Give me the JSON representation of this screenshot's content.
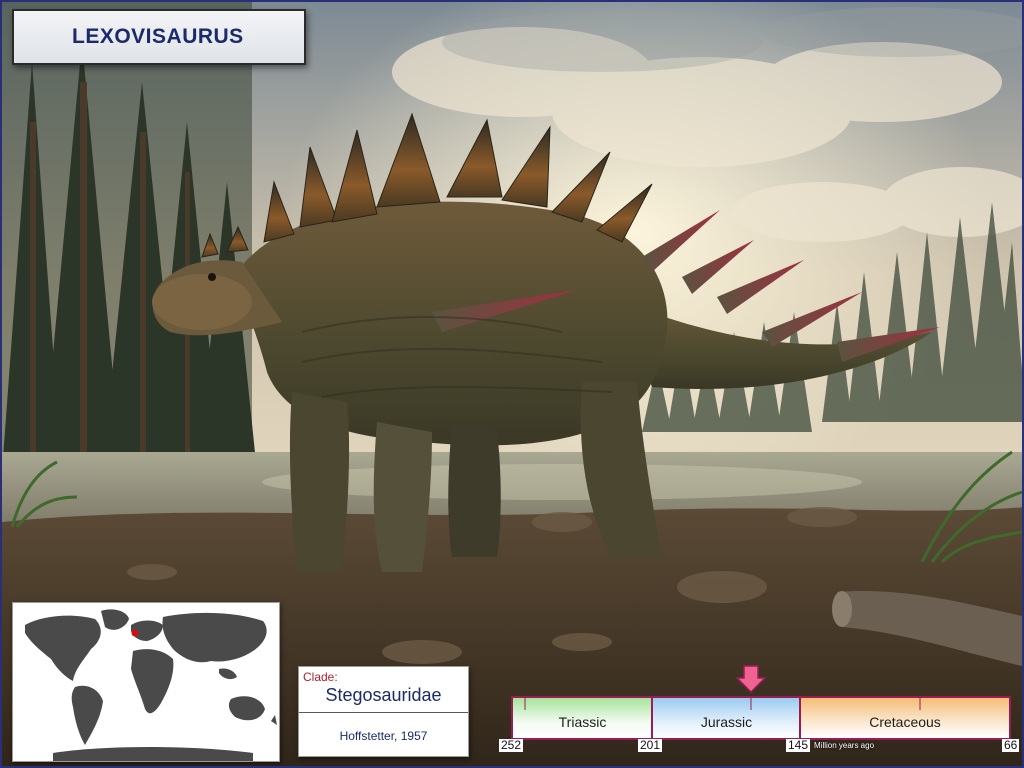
{
  "title": "LEXOVISAURUS",
  "clade": {
    "label": "Clade:",
    "name": "Stegosauridae",
    "author": "Hoffstetter, 1957"
  },
  "map": {
    "location_marker_color": "#cc1111"
  },
  "timeline": {
    "periods": [
      {
        "name": "Triassic",
        "color": "#a6e49b"
      },
      {
        "name": "Jurassic",
        "color": "#9ccbf0"
      },
      {
        "name": "Cretaceous",
        "color": "#f4bd76"
      }
    ],
    "ticks": [
      "252",
      "201",
      "145",
      "66"
    ],
    "unit": "Million years ago",
    "marker_color": "#f06292"
  },
  "colors": {
    "title_text": "#1b2a6b",
    "frame": "#2a2f7a",
    "timeline_border": "#9b1c54"
  }
}
